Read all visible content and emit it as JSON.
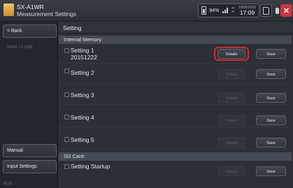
{
  "app": {
    "title": "SX-A1WR",
    "subtitle": "Measurement Settings"
  },
  "status": {
    "battery": "94%",
    "date": "10/05/2016",
    "time": "17:09",
    "close_label": "✕"
  },
  "sidebar": {
    "back_label": "< Back",
    "save_load_label": "Save / Load",
    "manual_label": "Manual",
    "input_settings_label": "Input Settings",
    "footer": "02.01"
  },
  "main": {
    "title": "Setting",
    "internal_memory_label": "Internal Memory",
    "sd_card_label": "SD Card",
    "rows": [
      {
        "name": "Setting 1",
        "sub": "20151222",
        "details": "Details",
        "save": "Save"
      },
      {
        "name": "Setting 2",
        "sub": "",
        "details": "Details",
        "save": "Save"
      },
      {
        "name": "Setting 3",
        "sub": "",
        "details": "Details",
        "save": "Save"
      },
      {
        "name": "Setting 4",
        "sub": "",
        "details": "Details",
        "save": "Save"
      },
      {
        "name": "Setting 5",
        "sub": "",
        "details": "Details",
        "save": "Save"
      }
    ],
    "startup": {
      "name": "Setting Startup",
      "details": "Details",
      "save": "Save"
    }
  }
}
